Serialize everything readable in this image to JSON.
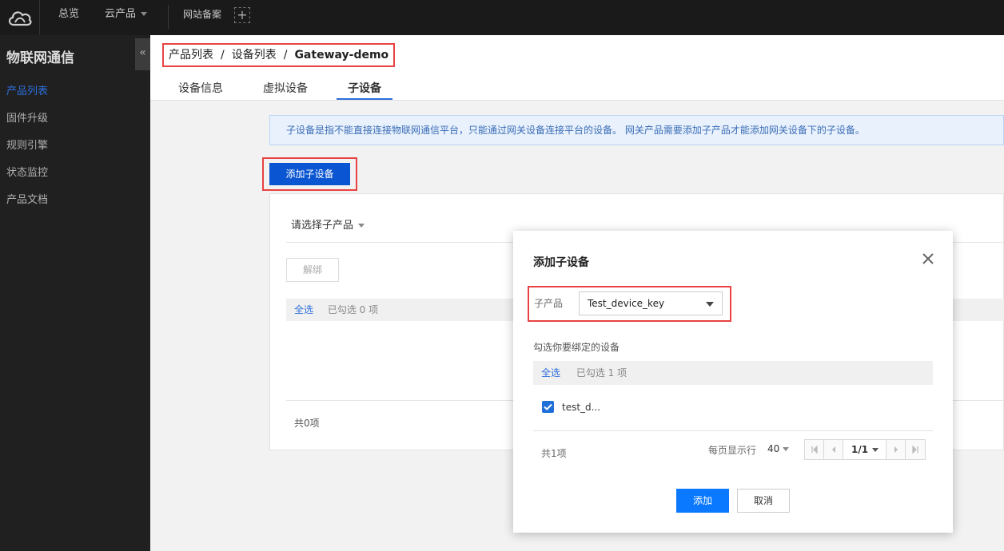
{
  "topbar": {
    "nav": [
      "总览",
      "云产品",
      "网站备案"
    ],
    "plus": "+"
  },
  "sidebar": {
    "title": "物联网通信",
    "collapse": "«",
    "items": [
      "产品列表",
      "固件升级",
      "规则引擎",
      "状态监控",
      "产品文档"
    ],
    "active_index": 0
  },
  "header": {
    "breadcrumb": [
      "产品列表",
      "设备列表",
      "Gateway-demo"
    ],
    "breadcrumb_sep": "/",
    "tabs": [
      "设备信息",
      "虚拟设备",
      "子设备"
    ],
    "active_tab": 2
  },
  "notice": "子设备是指不能直接连接物联网通信平台，只能通过网关设备连接平台的设备。 网关产品需要添加子产品才能添加网关设备下的子设备。",
  "add_button": "添加子设备",
  "panel": {
    "select_placeholder": "请选择子产品",
    "unbind": "解绑",
    "select_all": "全选",
    "selected_count": "已勾选 0 项",
    "total": "共0项"
  },
  "modal": {
    "title": "添加子设备",
    "sub_product_label": "子产品",
    "sub_product_value": "Test_device_key",
    "hint": "勾选你要绑定的设备",
    "select_all": "全选",
    "selected_count": "已勾选 1 项",
    "device": "test_d...",
    "total": "共1项",
    "per_page_label": "每页显示行",
    "per_page_value": "40",
    "page": "1/1",
    "confirm": "添加",
    "cancel": "取消"
  },
  "colors": {
    "accent": "#2d6edb",
    "primary_button": "#0a55d1",
    "highlight": "#e94242"
  }
}
